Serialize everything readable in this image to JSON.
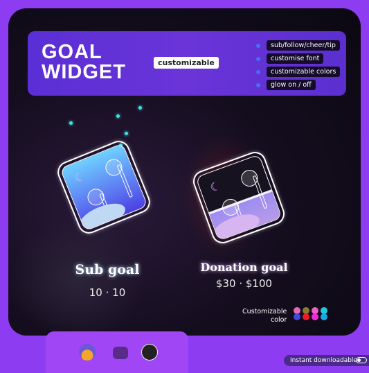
{
  "banner": {
    "title_line1": "GOAL",
    "title_line2": "WIDGET",
    "chip": "customizable",
    "features": [
      "sub/follow/cheer/tip",
      "customise font",
      "customizable colors",
      "glow on / off"
    ]
  },
  "widgets": [
    {
      "label": "Sub goal",
      "current": "10",
      "target": "10",
      "separator": "·",
      "progress": 1.0,
      "icon": "earbuds-icon"
    },
    {
      "label": "Donation goal",
      "current": "$30",
      "target": "$100",
      "separator": "·",
      "progress": 0.3,
      "icon": "earbuds-icon"
    }
  ],
  "colors": {
    "label_line1": "Customizable",
    "label_line2": "color",
    "pairs": [
      [
        "#e26ab8",
        "#4348e0"
      ],
      [
        "#8a7a30",
        "#f0182a"
      ],
      [
        "#ee5cc8",
        "#ee2ad8"
      ],
      [
        "#22c8e0",
        "#1aa8e8"
      ]
    ]
  },
  "platforms": [
    "streamlabs-icon",
    "twitch-icon",
    "obs-icon"
  ],
  "badge": {
    "label": "Instant downloadable"
  }
}
